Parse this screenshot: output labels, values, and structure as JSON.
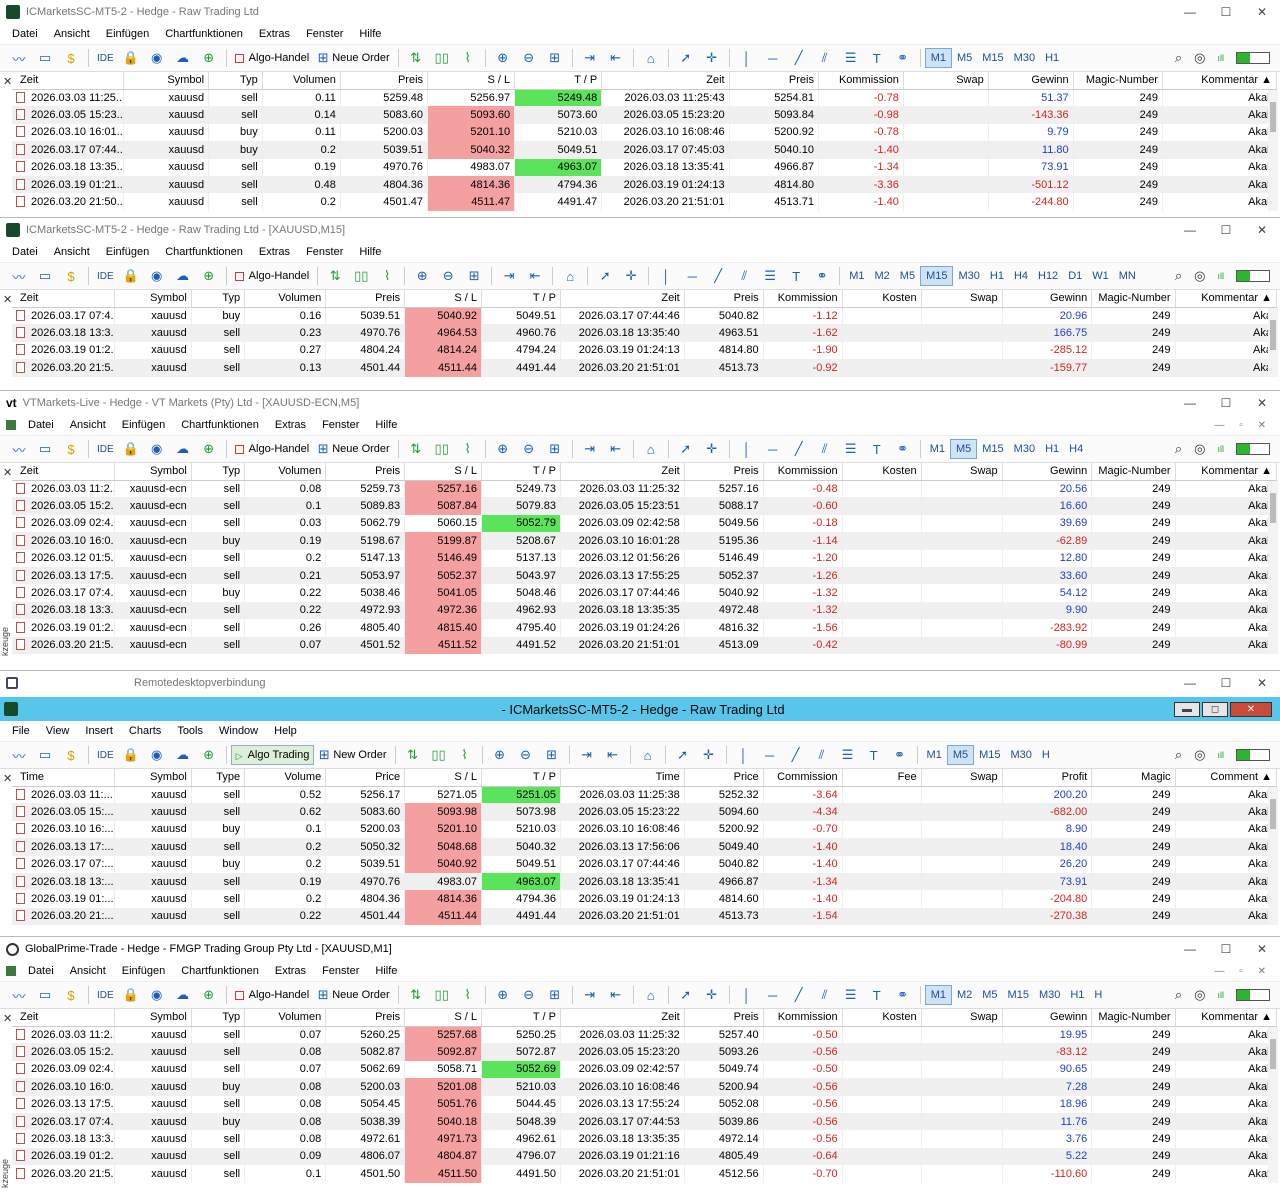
{
  "windows": [
    {
      "title": "ICMarketsSC-MT5-2 - Hedge - Raw Trading Ltd",
      "menu": [
        "Datei",
        "Ansicht",
        "Einfügen",
        "Chartfunktionen",
        "Extras",
        "Fenster",
        "Hilfe"
      ],
      "toolbar": {
        "ide": "IDE",
        "algo": "Algo-Handel",
        "order": "Neue Order",
        "timeframes": [
          "M1",
          "M5",
          "M15",
          "M30",
          "H1"
        ],
        "active_tf": "M1"
      },
      "columns": [
        "Zeit",
        "Symbol",
        "Typ",
        "Volumen",
        "Preis",
        "S / L",
        "T / P",
        "Zeit",
        "Preis",
        "Kommission",
        "Swap",
        "Gewinn",
        "Magic-Number",
        "Kommentar ▲"
      ],
      "rows": [
        [
          "2026.03.03 11:25...",
          "xauusd",
          "sell",
          "0.11",
          "5259.48",
          "5256.97",
          "5249.48",
          "2026.03.03 11:25:43",
          "5254.81",
          "-0.78",
          "",
          "51.37",
          "249",
          "Akali"
        ],
        [
          "2026.03.05 15:23...",
          "xauusd",
          "sell",
          "0.14",
          "5083.60",
          "5093.60",
          "5073.60",
          "2026.03.05 15:23:20",
          "5093.84",
          "-0.98",
          "",
          "-143.36",
          "249",
          "Akali"
        ],
        [
          "2026.03.10 16:01...",
          "xauusd",
          "buy",
          "0.11",
          "5200.03",
          "5201.10",
          "5210.03",
          "2026.03.10 16:08:46",
          "5200.92",
          "-0.78",
          "",
          "9.79",
          "249",
          "Akali"
        ],
        [
          "2026.03.17 07:44...",
          "xauusd",
          "buy",
          "0.2",
          "5039.51",
          "5040.32",
          "5049.51",
          "2026.03.17 07:45:03",
          "5040.10",
          "-1.40",
          "",
          "11.80",
          "249",
          "Akali"
        ],
        [
          "2026.03.18 13:35...",
          "xauusd",
          "sell",
          "0.19",
          "4970.76",
          "4983.07",
          "4963.07",
          "2026.03.18 13:35:41",
          "4966.87",
          "-1.34",
          "",
          "73.91",
          "249",
          "Akali"
        ],
        [
          "2026.03.19 01:21...",
          "xauusd",
          "sell",
          "0.48",
          "4804.36",
          "4814.36",
          "4794.36",
          "2026.03.19 01:24:13",
          "4814.80",
          "-3.36",
          "",
          "-501.12",
          "249",
          "Akali"
        ],
        [
          "2026.03.20 21:50...",
          "xauusd",
          "sell",
          "0.2",
          "4501.47",
          "4511.47",
          "4491.47",
          "2026.03.20 21:51:01",
          "4513.71",
          "-1.40",
          "",
          "-244.80",
          "249",
          "Akali"
        ]
      ],
      "sl_red": [
        1,
        2,
        3,
        5,
        6
      ],
      "tp_green": [
        0,
        4
      ]
    },
    {
      "title": "ICMarketsSC-MT5-2 - Hedge - Raw Trading Ltd - [XAUUSD,M15]",
      "menu": [
        "Datei",
        "Ansicht",
        "Einfügen",
        "Chartfunktionen",
        "Extras",
        "Fenster",
        "Hilfe"
      ],
      "toolbar": {
        "ide": "IDE",
        "algo": "Algo-Handel",
        "timeframes": [
          "M1",
          "M2",
          "M5",
          "M15",
          "M30",
          "H1",
          "H4",
          "H12",
          "D1",
          "W1",
          "MN"
        ],
        "active_tf": "M15"
      },
      "columns": [
        "Zeit",
        "Symbol",
        "Typ",
        "Volumen",
        "Preis",
        "S / L",
        "T / P",
        "Zeit",
        "Preis",
        "Kommission",
        "Kosten",
        "Swap",
        "Gewinn",
        "Magic-Number",
        "Kommentar ▲"
      ],
      "rows": [
        [
          "2026.03.17 07:4...",
          "xauusd",
          "buy",
          "0.16",
          "5039.51",
          "5040.92",
          "5049.51",
          "2026.03.17 07:44:46",
          "5040.82",
          "-1.12",
          "",
          "",
          "20.96",
          "249",
          "Aka"
        ],
        [
          "2026.03.18 13:3...",
          "xauusd",
          "sell",
          "0.23",
          "4970.76",
          "4964.53",
          "4960.76",
          "2026.03.18 13:35:40",
          "4963.51",
          "-1.62",
          "",
          "",
          "166.75",
          "249",
          "Aka"
        ],
        [
          "2026.03.19 01:2...",
          "xauusd",
          "sell",
          "0.27",
          "4804.24",
          "4814.24",
          "4794.24",
          "2026.03.19 01:24:13",
          "4814.80",
          "-1.90",
          "",
          "",
          "-285.12",
          "249",
          "Aka"
        ],
        [
          "2026.03.20 21:5...",
          "xauusd",
          "sell",
          "0.13",
          "4501.44",
          "4511.44",
          "4491.44",
          "2026.03.20 21:51:01",
          "4513.73",
          "-0.92",
          "",
          "",
          "-159.77",
          "249",
          "Aka"
        ]
      ],
      "sl_red": [
        0,
        1,
        2,
        3
      ],
      "tp_green": []
    },
    {
      "title": "VTMarkets-Live - Hedge - VT Markets (Pty) Ltd - [XAUUSD-ECN,M5]",
      "menu": [
        "Datei",
        "Ansicht",
        "Einfügen",
        "Chartfunktionen",
        "Extras",
        "Fenster",
        "Hilfe"
      ],
      "toolbar": {
        "ide": "IDE",
        "algo": "Algo-Handel",
        "order": "Neue Order",
        "timeframes": [
          "M1",
          "M5",
          "M15",
          "M30",
          "H1",
          "H4"
        ],
        "active_tf": "M5"
      },
      "columns": [
        "Zeit",
        "Symbol",
        "Typ",
        "Volumen",
        "Preis",
        "S / L",
        "T / P",
        "Zeit",
        "Preis",
        "Kommission",
        "Kosten",
        "Swap",
        "Gewinn",
        "Magic-Number",
        "Kommentar ▲"
      ],
      "rows": [
        [
          "2026.03.03 11:2...",
          "xauusd-ecn",
          "sell",
          "0.08",
          "5259.73",
          "5257.16",
          "5249.73",
          "2026.03.03 11:25:32",
          "5257.16",
          "-0.48",
          "",
          "",
          "20.56",
          "249",
          "Akali"
        ],
        [
          "2026.03.05 15:2...",
          "xauusd-ecn",
          "sell",
          "0.1",
          "5089.83",
          "5087.84",
          "5079.83",
          "2026.03.05 15:23:51",
          "5088.17",
          "-0.60",
          "",
          "",
          "16.60",
          "249",
          "Akali"
        ],
        [
          "2026.03.09 02:4...",
          "xauusd-ecn",
          "sell",
          "0.03",
          "5062.79",
          "5060.15",
          "5052.79",
          "2026.03.09 02:42:58",
          "5049.56",
          "-0.18",
          "",
          "",
          "39.69",
          "249",
          "Akali"
        ],
        [
          "2026.03.10 16:0...",
          "xauusd-ecn",
          "buy",
          "0.19",
          "5198.67",
          "5199.87",
          "5208.67",
          "2026.03.10 16:01:28",
          "5195.36",
          "-1.14",
          "",
          "",
          "-62.89",
          "249",
          "Akali"
        ],
        [
          "2026.03.12 01:5...",
          "xauusd-ecn",
          "sell",
          "0.2",
          "5147.13",
          "5146.49",
          "5137.13",
          "2026.03.12 01:56:26",
          "5146.49",
          "-1.20",
          "",
          "",
          "12.80",
          "249",
          "Akali"
        ],
        [
          "2026.03.13 17:5...",
          "xauusd-ecn",
          "sell",
          "0.21",
          "5053.97",
          "5052.37",
          "5043.97",
          "2026.03.13 17:55:25",
          "5052.37",
          "-1.26",
          "",
          "",
          "33.60",
          "249",
          "Akali"
        ],
        [
          "2026.03.17 07:4...",
          "xauusd-ecn",
          "buy",
          "0.22",
          "5038.46",
          "5041.05",
          "5048.46",
          "2026.03.17 07:44:46",
          "5040.92",
          "-1.32",
          "",
          "",
          "54.12",
          "249",
          "Akali"
        ],
        [
          "2026.03.18 13:3...",
          "xauusd-ecn",
          "sell",
          "0.22",
          "4972.93",
          "4972.36",
          "4962.93",
          "2026.03.18 13:35:35",
          "4972.48",
          "-1.32",
          "",
          "",
          "9.90",
          "249",
          "Akali"
        ],
        [
          "2026.03.19 01:2...",
          "xauusd-ecn",
          "sell",
          "0.26",
          "4805.40",
          "4815.40",
          "4795.40",
          "2026.03.19 01:24:26",
          "4816.32",
          "-1.56",
          "",
          "",
          "-283.92",
          "249",
          "Akali"
        ],
        [
          "2026.03.20 21:5...",
          "xauusd-ecn",
          "sell",
          "0.07",
          "4501.52",
          "4511.52",
          "4491.52",
          "2026.03.20 21:51:01",
          "4513.09",
          "-0.42",
          "",
          "",
          "-80.99",
          "249",
          "Akali"
        ]
      ],
      "sl_red": [
        0,
        1,
        3,
        4,
        5,
        6,
        7,
        8,
        9
      ],
      "tp_green": [
        2
      ]
    },
    {
      "title": "Remotedesktopverbindung"
    },
    {
      "title": "- ICMarketsSC-MT5-2 - Hedge - Raw Trading Ltd",
      "menu": [
        "File",
        "View",
        "Insert",
        "Charts",
        "Tools",
        "Window",
        "Help"
      ],
      "toolbar": {
        "ide": "IDE",
        "algo": "Algo Trading",
        "order": "New Order",
        "timeframes": [
          "M1",
          "M5",
          "M15",
          "M30",
          "H"
        ],
        "active_tf": "M5"
      },
      "columns": [
        "Time",
        "Symbol",
        "Type",
        "Volume",
        "Price",
        "S / L",
        "T / P",
        "Time",
        "Price",
        "Commission",
        "Fee",
        "Swap",
        "Profit",
        "Magic",
        "Comment ▲"
      ],
      "rows": [
        [
          "2026.03.03 11:...",
          "xauusd",
          "sell",
          "0.52",
          "5256.17",
          "5271.05",
          "5251.05",
          "2026.03.03 11:25:38",
          "5252.32",
          "-3.64",
          "",
          "",
          "200.20",
          "249",
          "Akali"
        ],
        [
          "2026.03.05 15:...",
          "xauusd",
          "sell",
          "0.62",
          "5083.60",
          "5093.98",
          "5073.98",
          "2026.03.05 15:23:22",
          "5094.60",
          "-4.34",
          "",
          "",
          "-682.00",
          "249",
          "Akali"
        ],
        [
          "2026.03.10 16:...",
          "xauusd",
          "buy",
          "0.1",
          "5200.03",
          "5201.10",
          "5210.03",
          "2026.03.10 16:08:46",
          "5200.92",
          "-0.70",
          "",
          "",
          "8.90",
          "249",
          "Akali"
        ],
        [
          "2026.03.13 17:...",
          "xauusd",
          "sell",
          "0.2",
          "5050.32",
          "5048.68",
          "5040.32",
          "2026.03.13 17:56:06",
          "5049.40",
          "-1.40",
          "",
          "",
          "18.40",
          "249",
          "Akali"
        ],
        [
          "2026.03.17 07:...",
          "xauusd",
          "buy",
          "0.2",
          "5039.51",
          "5040.92",
          "5049.51",
          "2026.03.17 07:44:46",
          "5040.82",
          "-1.40",
          "",
          "",
          "26.20",
          "249",
          "Akali"
        ],
        [
          "2026.03.18 13:...",
          "xauusd",
          "sell",
          "0.19",
          "4970.76",
          "4983.07",
          "4963.07",
          "2026.03.18 13:35:41",
          "4966.87",
          "-1.34",
          "",
          "",
          "73.91",
          "249",
          "Akali"
        ],
        [
          "2026.03.19 01:...",
          "xauusd",
          "sell",
          "0.2",
          "4804.36",
          "4814.36",
          "4794.36",
          "2026.03.19 01:24:13",
          "4814.60",
          "-1.40",
          "",
          "",
          "-204.80",
          "249",
          "Akali"
        ],
        [
          "2026.03.20 21:...",
          "xauusd",
          "sell",
          "0.22",
          "4501.44",
          "4511.44",
          "4491.44",
          "2026.03.20 21:51:01",
          "4513.73",
          "-1.54",
          "",
          "",
          "-270.38",
          "249",
          "Akali"
        ]
      ],
      "sl_red": [
        1,
        2,
        3,
        4,
        6,
        7
      ],
      "tp_green": [
        0,
        5
      ]
    },
    {
      "title": "GlobalPrime-Trade - Hedge - FMGP Trading Group Pty Ltd - [XAUUSD,M1]",
      "menu": [
        "Datei",
        "Ansicht",
        "Einfügen",
        "Chartfunktionen",
        "Extras",
        "Fenster",
        "Hilfe"
      ],
      "toolbar": {
        "ide": "IDE",
        "algo": "Algo-Handel",
        "order": "Neue Order",
        "timeframes": [
          "M1",
          "M2",
          "M5",
          "M15",
          "M30",
          "H1",
          "H"
        ],
        "active_tf": "M1"
      },
      "columns": [
        "Zeit",
        "Symbol",
        "Typ",
        "Volumen",
        "Preis",
        "S / L",
        "T / P",
        "Zeit",
        "Preis",
        "Kommission",
        "Kosten",
        "Swap",
        "Gewinn",
        "Magic-Number",
        "Kommentar ▲"
      ],
      "rows": [
        [
          "2026.03.03 11:2...",
          "xauusd",
          "sell",
          "0.07",
          "5260.25",
          "5257.68",
          "5250.25",
          "2026.03.03 11:25:32",
          "5257.40",
          "-0.50",
          "",
          "",
          "19.95",
          "249",
          "Akali"
        ],
        [
          "2026.03.05 15:2...",
          "xauusd",
          "sell",
          "0.08",
          "5082.87",
          "5092.87",
          "5072.87",
          "2026.03.05 15:23:20",
          "5093.26",
          "-0.56",
          "",
          "",
          "-83.12",
          "249",
          "Akali"
        ],
        [
          "2026.03.09 02:4...",
          "xauusd",
          "sell",
          "0.07",
          "5062.69",
          "5058.71",
          "5052.69",
          "2026.03.09 02:42:57",
          "5049.74",
          "-0.50",
          "",
          "",
          "90.65",
          "249",
          "Akali"
        ],
        [
          "2026.03.10 16:0...",
          "xauusd",
          "buy",
          "0.08",
          "5200.03",
          "5201.08",
          "5210.03",
          "2026.03.10 16:08:46",
          "5200.94",
          "-0.56",
          "",
          "",
          "7.28",
          "249",
          "Akali"
        ],
        [
          "2026.03.13 17:5...",
          "xauusd",
          "sell",
          "0.08",
          "5054.45",
          "5051.76",
          "5044.45",
          "2026.03.13 17:55:24",
          "5052.08",
          "-0.56",
          "",
          "",
          "18.96",
          "249",
          "Akali"
        ],
        [
          "2026.03.17 07:4...",
          "xauusd",
          "buy",
          "0.08",
          "5038.39",
          "5040.18",
          "5048.39",
          "2026.03.17 07:44:53",
          "5039.86",
          "-0.56",
          "",
          "",
          "11.76",
          "249",
          "Akali"
        ],
        [
          "2026.03.18 13:3...",
          "xauusd",
          "sell",
          "0.08",
          "4972.61",
          "4971.73",
          "4962.61",
          "2026.03.18 13:35:35",
          "4972.14",
          "-0.56",
          "",
          "",
          "3.76",
          "249",
          "Akali"
        ],
        [
          "2026.03.19 01:2...",
          "xauusd",
          "sell",
          "0.09",
          "4806.07",
          "4804.87",
          "4796.07",
          "2026.03.19 01:21:16",
          "4805.49",
          "-0.64",
          "",
          "",
          "5.22",
          "249",
          "Akali"
        ],
        [
          "2026.03.20 21:5...",
          "xauusd",
          "sell",
          "0.1",
          "4501.50",
          "4511.50",
          "4491.50",
          "2026.03.20 21:51:01",
          "4512.56",
          "-0.70",
          "",
          "",
          "-110.60",
          "249",
          "Akali"
        ]
      ],
      "sl_red": [
        0,
        1,
        3,
        4,
        5,
        6,
        7,
        8
      ],
      "tp_green": [
        2
      ]
    }
  ],
  "side_label": "kzeuge",
  "colors": {
    "sl_red": "#f5a0a0",
    "tp_green": "#5be35b",
    "loss": "#d3251f",
    "profit": "#1f3fc9",
    "active_title": "#56c7ea"
  }
}
